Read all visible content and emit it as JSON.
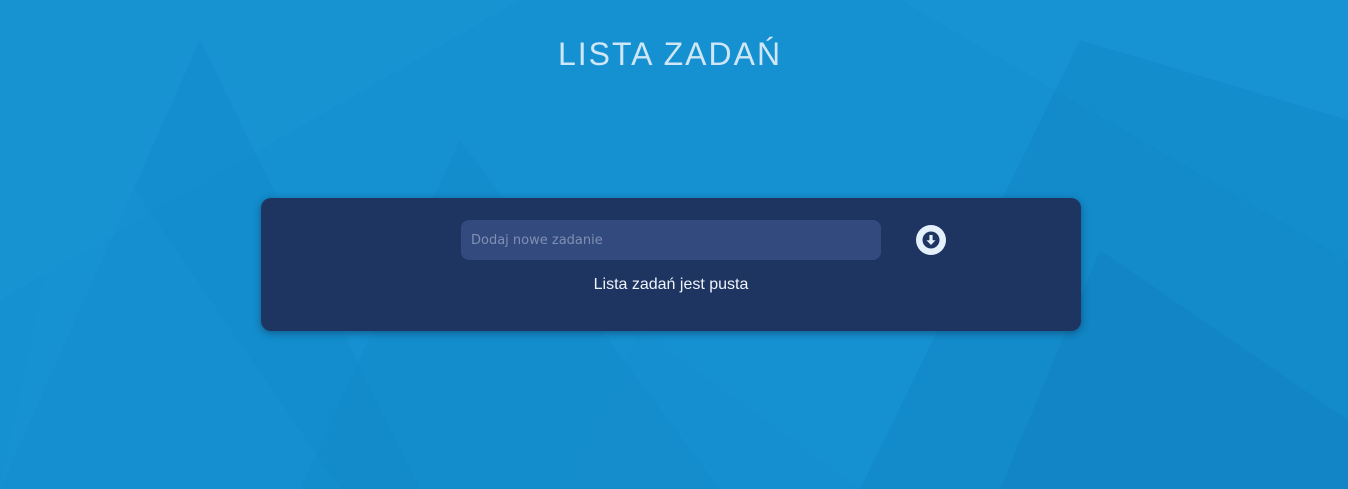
{
  "header": {
    "title": "LISTA ZADAŃ"
  },
  "task_form": {
    "input_placeholder": "Dodaj nowe zadanie",
    "input_value": "",
    "add_button_icon": "arrow-down-circle-icon"
  },
  "task_list": {
    "empty_message": "Lista zadań jest pusta",
    "items": []
  },
  "colors": {
    "background": "#1590d0",
    "panel": "#1e3562",
    "input": "#324a7e",
    "title": "#cfe6f7",
    "button": "#e4f0fb",
    "button_icon": "#1e3562"
  }
}
